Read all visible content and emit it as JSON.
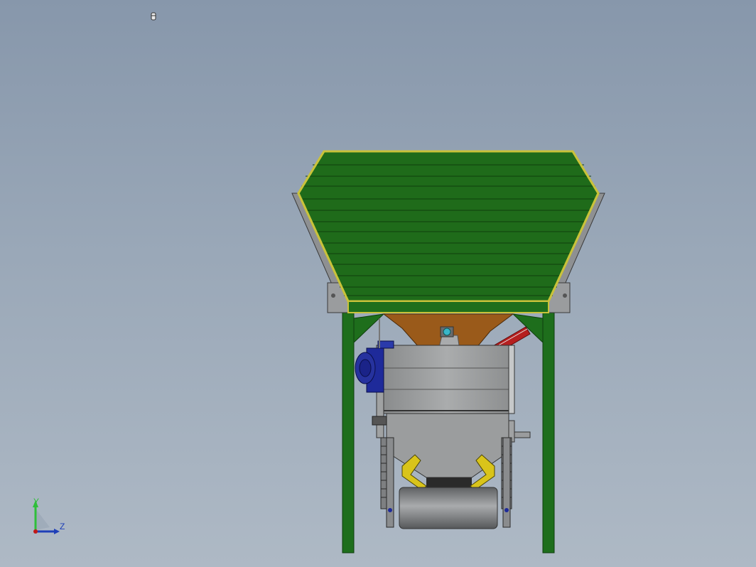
{
  "triad": {
    "y_label": "Y",
    "z_label": "Z",
    "colors": {
      "y_axis": "#2fbf3a",
      "z_axis": "#1f3fb8",
      "x_point": "#c01818"
    }
  },
  "model": {
    "colors": {
      "hopper_green": "#1f6b1a",
      "hopper_stripe": "#2d8a22",
      "hopper_rim": "#c9c23a",
      "frame_green": "#1e6e1c",
      "chute_brown": "#9a5a1a",
      "body_grey": "#9b9d9e",
      "roller_grey": "#7a7c7e",
      "motor_blue": "#1e2a9a",
      "cylinder_red": "#b51f1f",
      "yellow_guard": "#d9c41a"
    },
    "icons": [
      "small-marker-icon",
      "coordinate-triad-icon"
    ]
  }
}
